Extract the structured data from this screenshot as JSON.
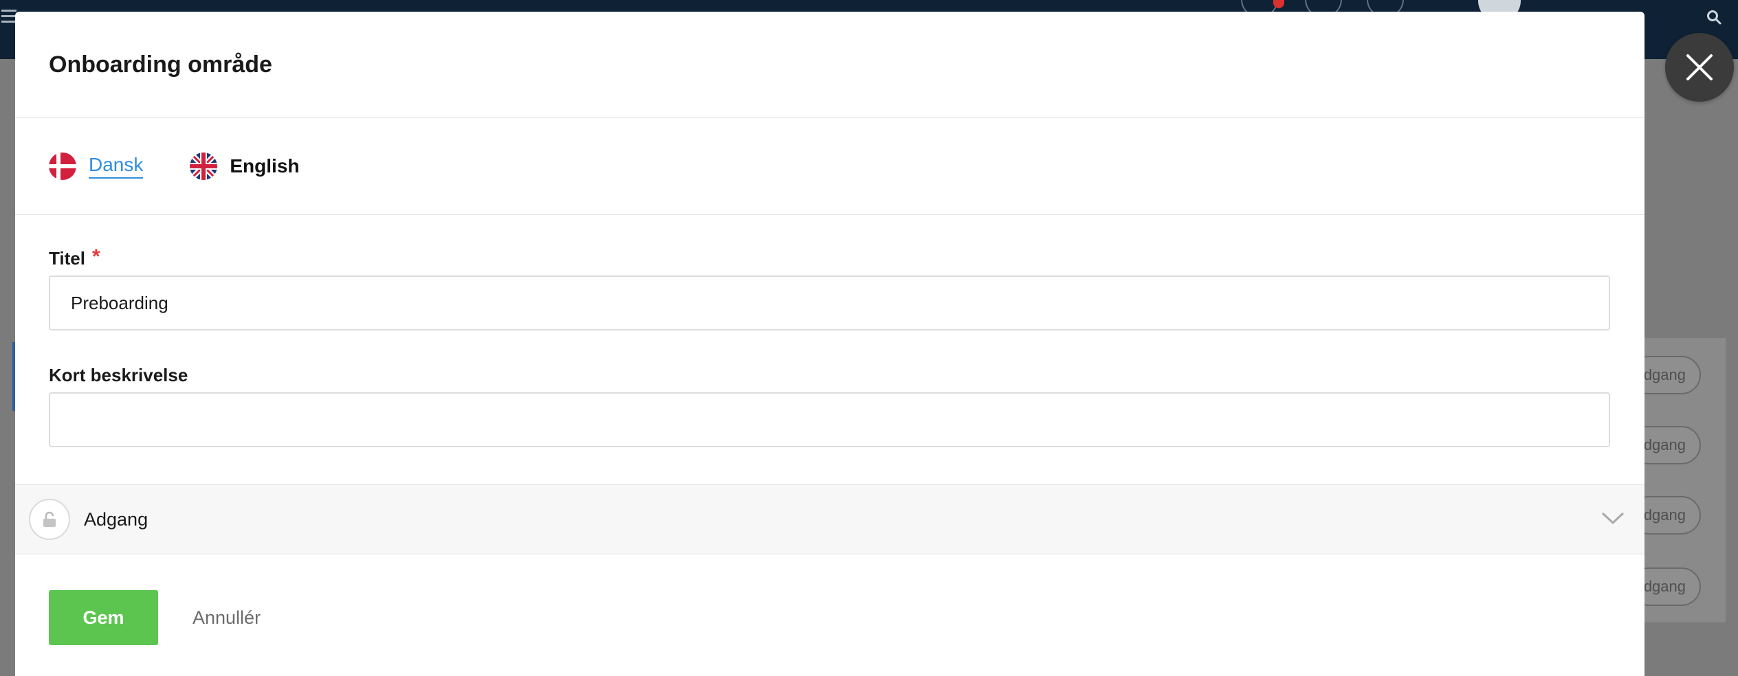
{
  "modal": {
    "title": "Onboarding område",
    "languages": [
      {
        "label": "Dansk",
        "active": true,
        "icon": "denmark-flag-icon"
      },
      {
        "label": "English",
        "active": false,
        "icon": "uk-flag-icon"
      }
    ],
    "fields": {
      "title": {
        "label": "Titel",
        "required_mark": "*",
        "value": "Preboarding",
        "placeholder": ""
      },
      "short_description": {
        "label": "Kort beskrivelse",
        "value": "",
        "placeholder": ""
      }
    },
    "access_section": {
      "label": "Adgang",
      "icon": "lock-icon",
      "expand_icon": "chevron-down-icon"
    },
    "footer": {
      "save_label": "Gem",
      "cancel_label": "Annullér"
    },
    "close_icon": "close-icon"
  },
  "background": {
    "access_pill_text": "dgang",
    "colors": {
      "topbar": "#0f2235",
      "overlay": "#7b7b7b"
    }
  },
  "colors": {
    "accent": "#2f8ee0",
    "primary_button": "#5cc54f",
    "required": "#e53b3b"
  }
}
